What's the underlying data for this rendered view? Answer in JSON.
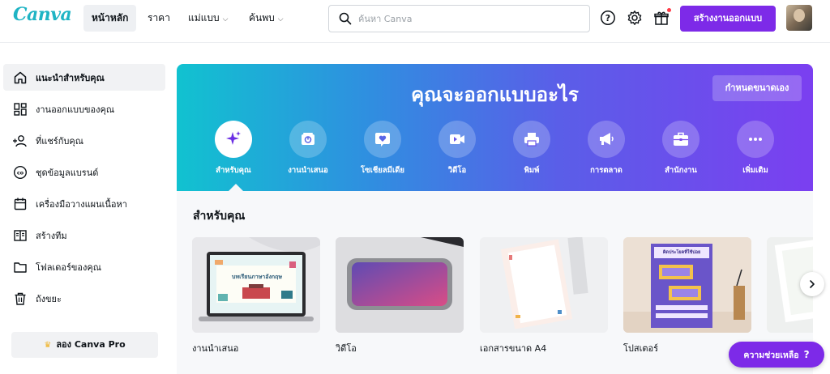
{
  "app": {
    "logo_text": "Canva"
  },
  "nav": {
    "items": [
      {
        "label": "หน้าหลัก",
        "active": true
      },
      {
        "label": "ราคา"
      },
      {
        "label": "แม่แบบ",
        "has_dropdown": true
      },
      {
        "label": "ค้นพบ",
        "has_dropdown": true
      }
    ],
    "search_placeholder": "ค้นหา Canva",
    "create_button": "สร้างงานออกแบบ",
    "icons": [
      "help-icon",
      "settings-icon",
      "gift-icon"
    ]
  },
  "sidebar": {
    "items": [
      {
        "label": "แนะนำสำหรับคุณ",
        "icon": "home-icon",
        "active": true
      },
      {
        "label": "งานออกแบบของคุณ",
        "icon": "grid-icon"
      },
      {
        "label": "ที่แชร์กับคุณ",
        "icon": "add-people-icon"
      },
      {
        "label": "ชุดข้อมูลแบรนด์",
        "icon": "brand-kit-icon"
      },
      {
        "label": "เครื่องมือวางแผนเนื้อหา",
        "icon": "calendar-icon"
      },
      {
        "label": "สร้างทีม",
        "icon": "team-icon"
      },
      {
        "label": "โฟลเดอร์ของคุณ",
        "icon": "folder-icon"
      },
      {
        "label": "ถังขยะ",
        "icon": "trash-icon"
      }
    ],
    "try_pro": "ลอง Canva Pro"
  },
  "hero": {
    "title": "คุณจะออกแบบอะไร",
    "custom_size": "กำหนดขนาดเอง",
    "categories": [
      {
        "label": "สำหรับคุณ",
        "icon": "sparkle-icon",
        "active": true
      },
      {
        "label": "งานนำเสนอ",
        "icon": "presentation-icon"
      },
      {
        "label": "โซเชียลมีเดีย",
        "icon": "heart-icon"
      },
      {
        "label": "วิดีโอ",
        "icon": "video-icon"
      },
      {
        "label": "พิมพ์",
        "icon": "print-icon"
      },
      {
        "label": "การตลาด",
        "icon": "megaphone-icon"
      },
      {
        "label": "สำนักงาน",
        "icon": "briefcase-icon"
      },
      {
        "label": "เพิ่มเติม",
        "icon": "more-icon"
      }
    ]
  },
  "for_you": {
    "title": "สำหรับคุณ",
    "cards": [
      {
        "label": "งานนำเสนอ",
        "thumb_text": "บทเรียนภาษาอังกฤษ"
      },
      {
        "label": "วิดีโอ"
      },
      {
        "label": "เอกสารขนาด A4"
      },
      {
        "label": "โปสเตอร์",
        "thumb_text": "คิดประโยคที่ใช้บ่อย"
      },
      {
        "label": "..."
      }
    ]
  },
  "help": {
    "label": "ความช่วยเหลือ",
    "mark": "?"
  },
  "colors": {
    "brand_purple": "#7d2ae8",
    "hero_start": "#11c2d0",
    "hero_end": "#7b3ff0"
  }
}
